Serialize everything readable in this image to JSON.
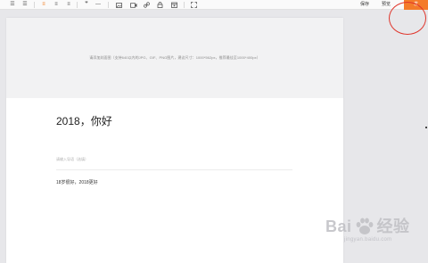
{
  "toolbar": {
    "save_label": "保存",
    "preview_label": "预览",
    "publish_label": "发"
  },
  "editor": {
    "cover_hint": "请添加封面图（支持640以内的JPG、GIF、PNG图片，建议尺寸：1000*562px，推荐最佳至1000*400px）",
    "title": "2018，你好",
    "summary_placeholder": "请输入导语（选填）",
    "body_text": "18岁很好，2018更好"
  },
  "watermark": {
    "text_main": "Bai",
    "text_after": "经验",
    "text_sub": "jingyan.baidu.com"
  },
  "colors": {
    "accent": "#f47b29",
    "annotation": "#e0352b",
    "active_icon": "#f07a1a"
  }
}
